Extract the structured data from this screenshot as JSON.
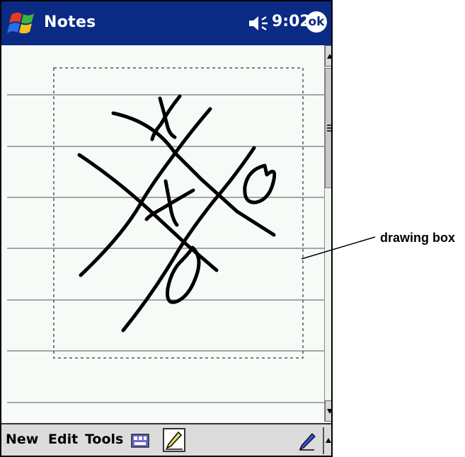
{
  "titlebar": {
    "app_title": "Notes",
    "time": "9:02",
    "ok_label": "ok"
  },
  "menubar": {
    "items": [
      "New",
      "Edit",
      "Tools"
    ]
  },
  "callout": {
    "label": "drawing box"
  }
}
